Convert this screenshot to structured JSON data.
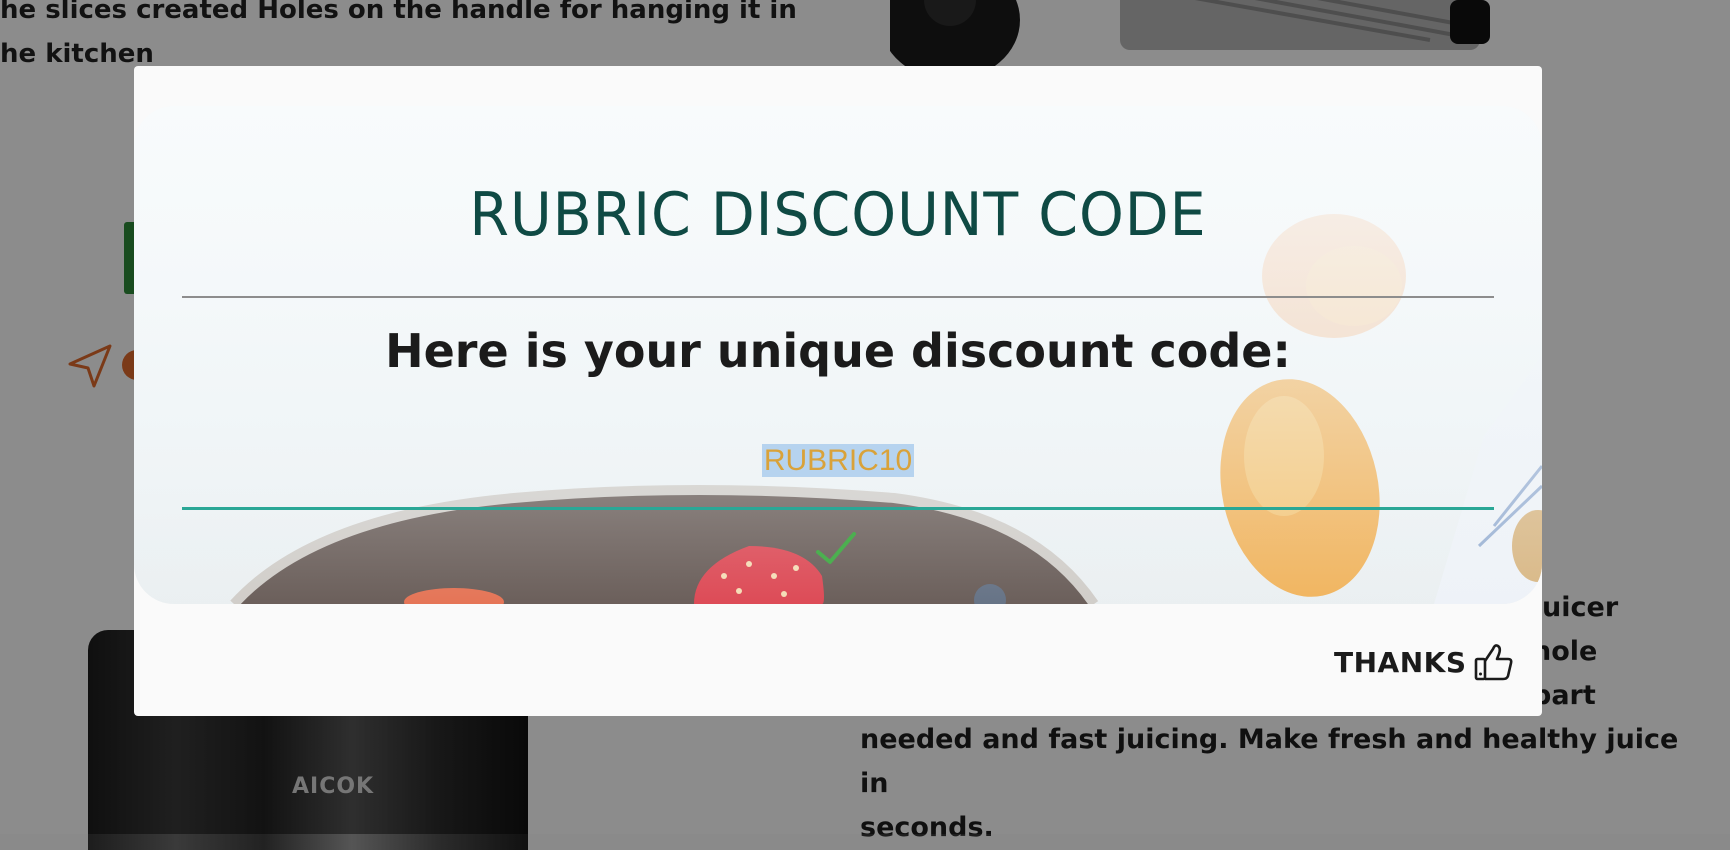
{
  "background": {
    "text_top": [
      "he slices created Holes on the handle for hanging it in",
      "he kitchen"
    ],
    "product_label": "AICOK",
    "description_lines": [
      "needed and fast juicing. Make fresh and healthy juice in",
      "seconds."
    ],
    "description_right_fragments": [
      "Juicer",
      "hole",
      "part"
    ]
  },
  "modal": {
    "title": "RUBRIC DISCOUNT CODE",
    "subtitle": "Here is your unique discount code:",
    "code": "RUBRIC10",
    "thanks_label": "THANKS"
  },
  "colors": {
    "title": "#0f4a44",
    "code": "#d9a23a",
    "code_highlight": "#b6d3ef",
    "code_underline": "#2aa796",
    "check": "#4caf50"
  }
}
